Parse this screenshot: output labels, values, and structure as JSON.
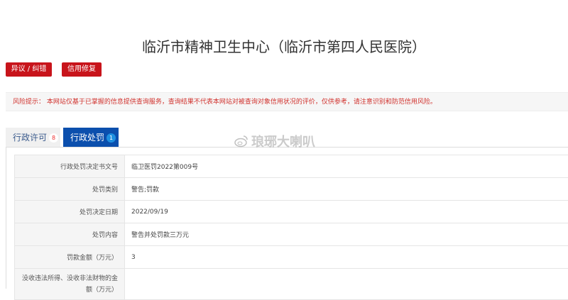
{
  "title": "临沂市精神卫生中心（临沂市第四人民医院）",
  "buttons": {
    "objection": "异议 / 纠错",
    "credit_repair": "信用修复"
  },
  "risk_notice": "风险提示： 本网站仅基于已掌握的信息提供查询服务，查询结果不代表本网站对被查询对象信用状况的评价，仅供参考，请注意识别和防范信用风险。",
  "tabs": [
    {
      "label": "行政许可",
      "count": "8"
    },
    {
      "label": "行政处罚",
      "count": "1"
    }
  ],
  "watermark": "琅琊大喇叭",
  "rows": [
    {
      "label": "行政处罚决定书文号",
      "value": "临卫医罚2022第009号"
    },
    {
      "label": "处罚类别",
      "value": "警告;罚款"
    },
    {
      "label": "处罚决定日期",
      "value": "2022/09/19"
    },
    {
      "label": "处罚内容",
      "value": "警告并处罚款三万元"
    },
    {
      "label": "罚款金额（万元）",
      "value": "3"
    },
    {
      "label": "没收违法所得、没收非法财物的金额（万元）",
      "value": ""
    }
  ]
}
